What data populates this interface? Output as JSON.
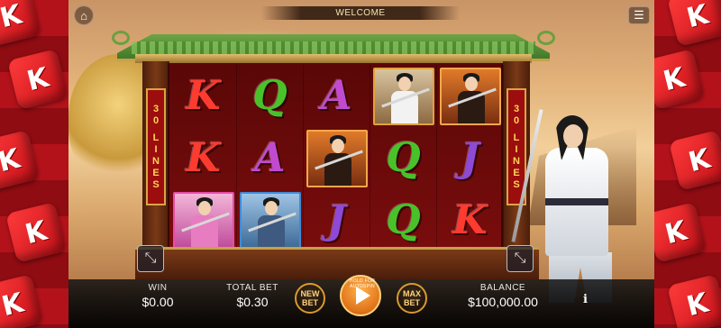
{
  "header": {
    "welcome_text": "WELCOME",
    "home_icon": "home-icon",
    "menu_icon": "hamburger-menu-icon"
  },
  "paylines": {
    "left_number": "30",
    "left_label": "LINES",
    "right_number": "30",
    "right_label": "LINES"
  },
  "reels": [
    [
      {
        "type": "letter",
        "value": "K"
      },
      {
        "type": "letter",
        "value": "K"
      },
      {
        "type": "character",
        "value": "lady-fan",
        "frame": "pink"
      }
    ],
    [
      {
        "type": "letter",
        "value": "Q"
      },
      {
        "type": "letter",
        "value": "A"
      },
      {
        "type": "character",
        "value": "swordswoman-hat",
        "frame": "blue"
      }
    ],
    [
      {
        "type": "letter",
        "value": "A"
      },
      {
        "type": "character",
        "value": "official-black-hat",
        "frame": "orange"
      },
      {
        "type": "letter",
        "value": "J"
      }
    ],
    [
      {
        "type": "character",
        "value": "swordsman-white",
        "frame": "tan"
      },
      {
        "type": "letter",
        "value": "Q"
      },
      {
        "type": "letter",
        "value": "Q"
      }
    ],
    [
      {
        "type": "character",
        "value": "official-black-hat",
        "frame": "orange"
      },
      {
        "type": "letter",
        "value": "J"
      },
      {
        "type": "letter",
        "value": "K"
      }
    ]
  ],
  "footer": {
    "win_label": "WIN",
    "win_value": "$0.00",
    "total_bet_label": "TOTAL BET",
    "total_bet_value": "$0.30",
    "new_bet_label": "NEW BET",
    "spin_hold_text": "HOLD FOR AUTOSPIN",
    "max_bet_label": "MAX BET",
    "balance_label": "BALANCE",
    "balance_value": "$100,000.00",
    "info_label": "i"
  },
  "colors": {
    "accent": "#d99a2e",
    "spin": "#e0731a",
    "roof": "#5e9a3c",
    "reel_bg": "#6a0a0a"
  }
}
